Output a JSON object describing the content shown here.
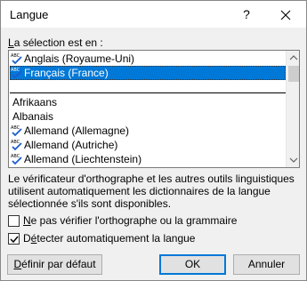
{
  "window": {
    "title": "Langue",
    "help_glyph": "?",
    "close_icon": "close-icon"
  },
  "selection": {
    "label_access": "L",
    "label_rest": "a sélection est en :"
  },
  "languages": {
    "top": [
      {
        "name": "Anglais (Royaume-Uni)",
        "spell_icon": true,
        "selected": false
      },
      {
        "name": "Français (France)",
        "spell_icon": true,
        "selected": true
      }
    ],
    "all": [
      {
        "name": "Afrikaans",
        "spell_icon": false
      },
      {
        "name": "Albanais",
        "spell_icon": false
      },
      {
        "name": "Allemand (Allemagne)",
        "spell_icon": true
      },
      {
        "name": "Allemand (Autriche)",
        "spell_icon": true
      },
      {
        "name": "Allemand (Liechtenstein)",
        "spell_icon": true
      }
    ]
  },
  "info_text": "Le vérificateur d'orthographe et les autres outils linguistiques utilisent automatiquement les dictionnaires de la langue sélectionnée s'ils sont disponibles.",
  "options": {
    "no_check": {
      "access": "N",
      "rest": "e pas vérifier l'orthographe ou la grammaire",
      "checked": false
    },
    "detect": {
      "pre": "D",
      "access": "é",
      "rest": "tecter automatiquement la langue",
      "checked": true
    }
  },
  "buttons": {
    "default_access": "D",
    "default_rest": "éfinir par défaut",
    "ok": "OK",
    "cancel": "Annuler"
  },
  "colors": {
    "selection": "#0078d7",
    "spell_check_blue": "#1e5bd0",
    "spell_red": "#c00000"
  }
}
